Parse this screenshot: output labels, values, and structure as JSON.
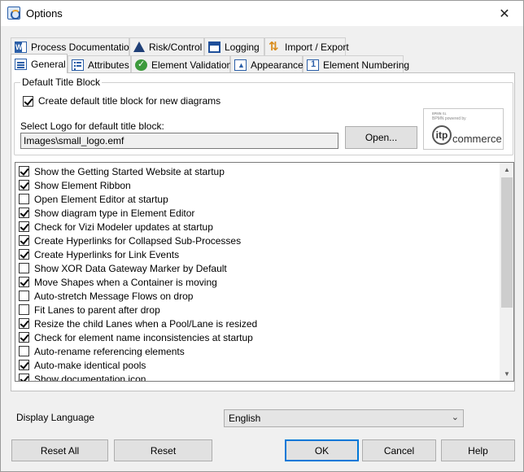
{
  "window": {
    "title": "Options",
    "close_glyph": "✕"
  },
  "tabs_row1": [
    {
      "label": "Process Documentation",
      "icon": "word-doc-icon"
    },
    {
      "label": "Risk/Control",
      "icon": "risk-triangle-icon"
    },
    {
      "label": "Logging",
      "icon": "logging-window-icon"
    },
    {
      "label": "Import / Export",
      "icon": "import-export-icon"
    }
  ],
  "tabs_row2": [
    {
      "label": "General",
      "icon": "general-list-icon",
      "active": true
    },
    {
      "label": "Attributes",
      "icon": "attributes-icon"
    },
    {
      "label": "Element Validation",
      "icon": "validation-check-icon"
    },
    {
      "label": "Appearance",
      "icon": "appearance-icon"
    },
    {
      "label": "Element Numbering",
      "icon": "numbering-icon"
    }
  ],
  "title_block": {
    "legend": "Default Title Block",
    "create_label": "Create default title block for new diagrams",
    "create_checked": true,
    "logo_label": "Select Logo for default title block:",
    "logo_path": "Images\\small_logo.emf",
    "open_button": "Open...",
    "logo": {
      "small_line1": "ʙᴘᴍɴ ɢʟ",
      "small_line2": "BPMN powered by",
      "circle": "itp",
      "word": "commerce"
    }
  },
  "options": [
    {
      "label": "Show the Getting Started Website at startup",
      "checked": true
    },
    {
      "label": "Show Element Ribbon",
      "checked": true
    },
    {
      "label": "Open Element Editor at startup",
      "checked": false
    },
    {
      "label": "Show diagram type in Element Editor",
      "checked": true
    },
    {
      "label": "Check for Vizi Modeler updates at startup",
      "checked": true
    },
    {
      "label": "Create Hyperlinks for Collapsed Sub-Processes",
      "checked": true
    },
    {
      "label": "Create Hyperlinks for Link Events",
      "checked": true
    },
    {
      "label": "Show XOR Data Gateway Marker by Default",
      "checked": false
    },
    {
      "label": "Move Shapes when a Container is moving",
      "checked": true
    },
    {
      "label": "Auto-stretch Message Flows on drop",
      "checked": false
    },
    {
      "label": "Fit Lanes to parent after drop",
      "checked": false
    },
    {
      "label": "Resize the child Lanes when a Pool/Lane is resized",
      "checked": true
    },
    {
      "label": "Check for element name inconsistencies at startup",
      "checked": true
    },
    {
      "label": "Auto-rename referencing elements",
      "checked": false
    },
    {
      "label": "Auto-make identical pools",
      "checked": true
    },
    {
      "label": "Show documentation icon",
      "checked": true
    }
  ],
  "language": {
    "label": "Display Language",
    "value": "English"
  },
  "buttons": {
    "reset_all": "Reset All",
    "reset": "Reset",
    "ok": "OK",
    "cancel": "Cancel",
    "help": "Help"
  }
}
